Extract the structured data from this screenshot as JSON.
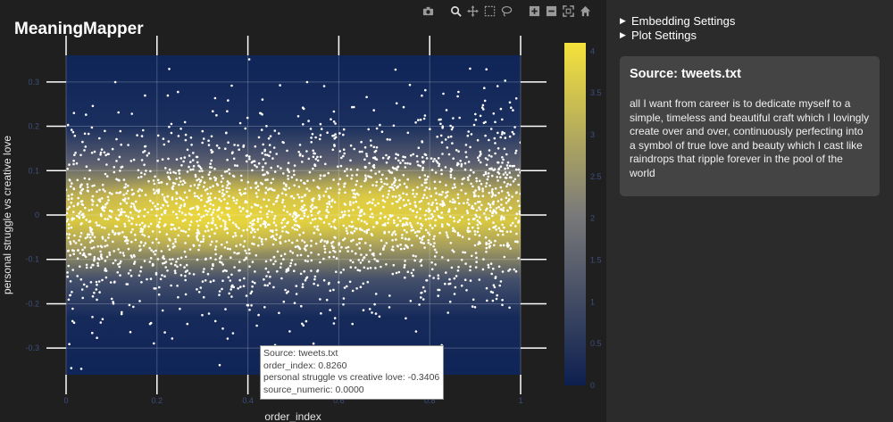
{
  "app": {
    "title": "MeaningMapper"
  },
  "modebar": {
    "buttons": [
      "camera-icon",
      "zoom-icon",
      "pan-icon",
      "box-select-icon",
      "lasso-icon",
      "zoom-in-icon",
      "zoom-out-icon",
      "autoscale-icon",
      "reset-axes-icon",
      "plotly-logo-icon"
    ]
  },
  "side": {
    "embedding_settings": "Embedding Settings",
    "plot_settings": "Plot Settings",
    "card_title": "Source: tweets.txt",
    "card_text": "all I want from career is to dedicate myself to a simple, timeless and beautiful craft which I lovingly create over and over, continuously perfecting into a symbol of true love and beauty which I cast like raindrops that ripple forever in the pool of the world"
  },
  "tooltip": {
    "line1": "Source: tweets.txt",
    "line2": "order_index: 0.8260",
    "line3": "personal struggle vs creative love: -0.3406",
    "line4": "source_numeric: 0.0000"
  },
  "chart_data": {
    "type": "scatter",
    "title": "",
    "xlabel": "order_index",
    "ylabel": "personal struggle vs creative love",
    "xlim": [
      0,
      1
    ],
    "ylim": [
      -0.36,
      0.36
    ],
    "x_ticks": [
      "0",
      "0.2",
      "0.4",
      "0.6",
      "0.8",
      "1"
    ],
    "y_ticks": [
      "-0.3",
      "-0.2",
      "-0.1",
      "0",
      "0.1",
      "0.2",
      "0.3"
    ],
    "colorbar": {
      "ticks": [
        "0",
        "0.5",
        "1",
        "1.5",
        "2",
        "2.5",
        "3",
        "3.5",
        "4"
      ],
      "range": [
        0,
        4.1
      ],
      "colors": [
        "#0d1f4f",
        "#7a7a7a",
        "#f5e23b"
      ]
    },
    "density_background": true,
    "point_color": "#ffffff",
    "point_count_approx": 2500,
    "highlighted_point": {
      "order_index": 0.826,
      "value": -0.3406,
      "source_numeric": 0
    }
  }
}
